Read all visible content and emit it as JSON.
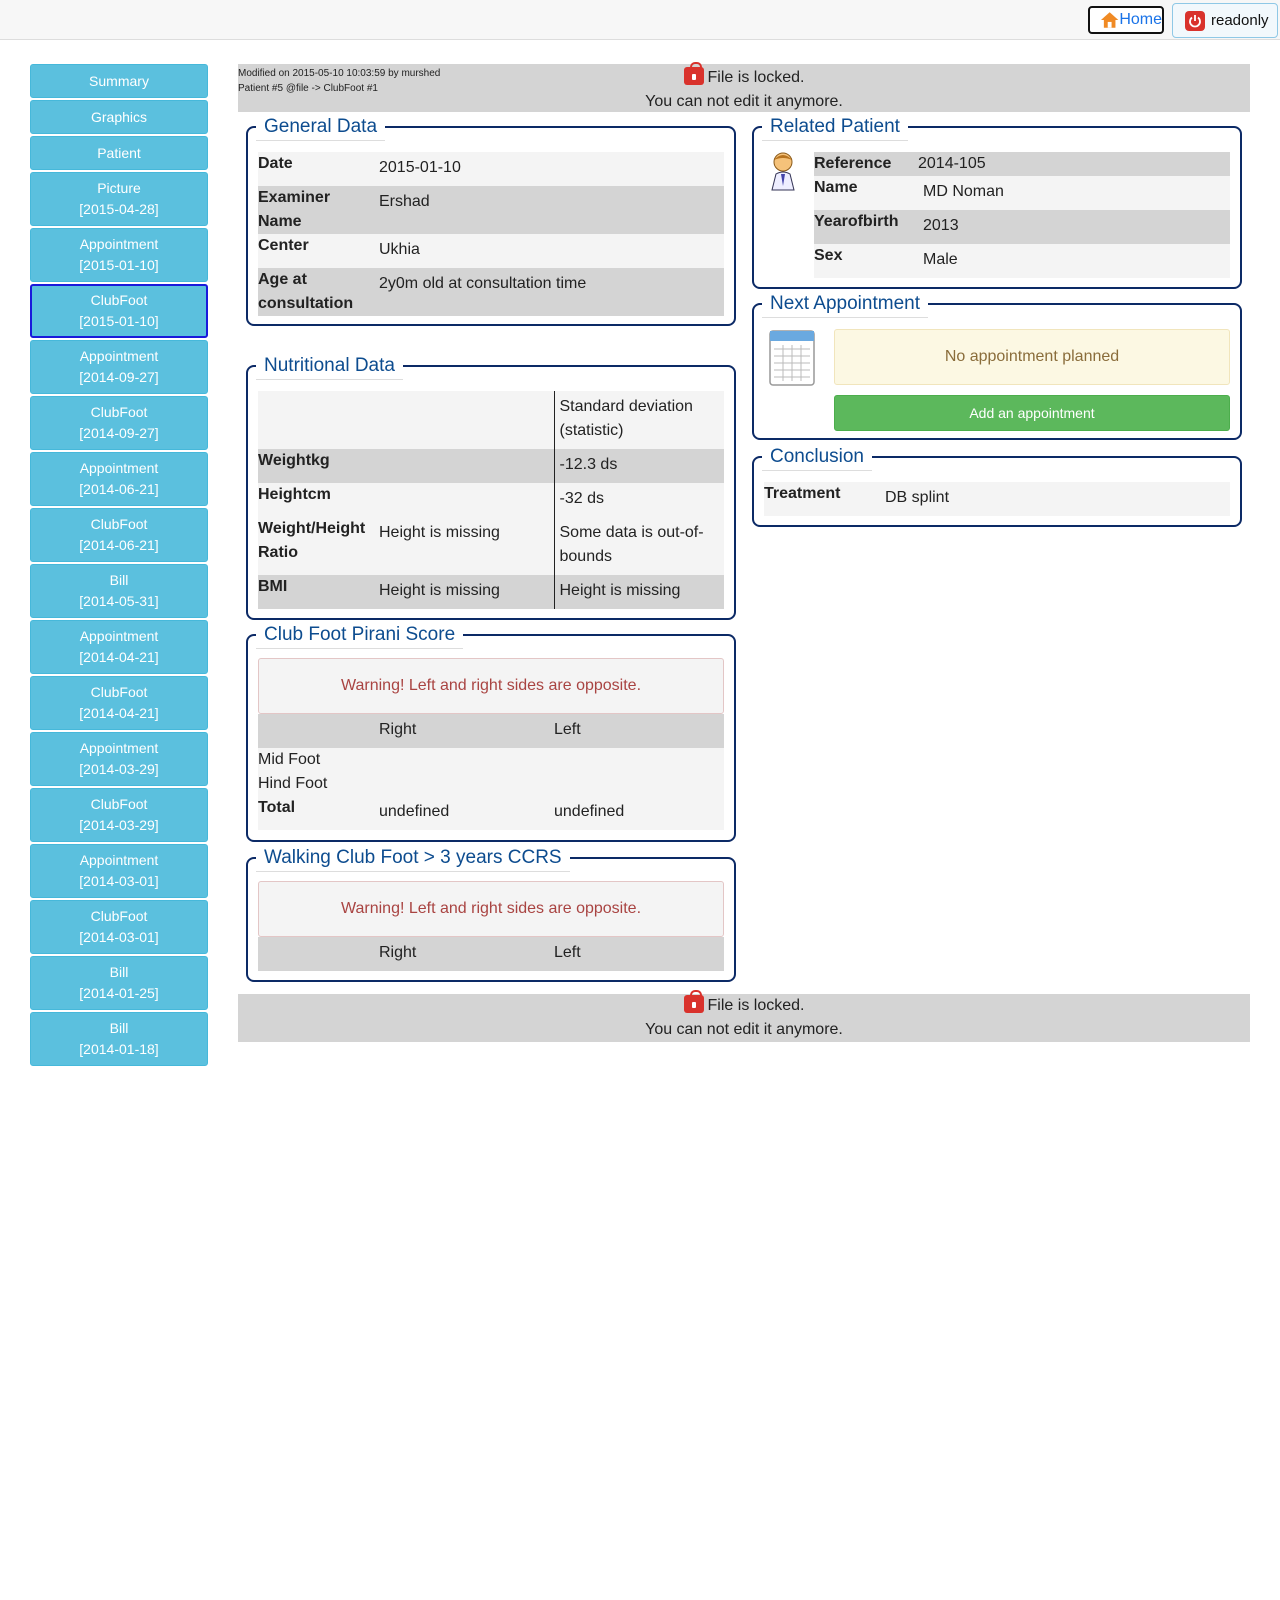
{
  "topbar": {
    "home_label": "Home",
    "readonly_label": "readonly"
  },
  "sidebar": {
    "items": [
      {
        "label": "Summary",
        "date": ""
      },
      {
        "label": "Graphics",
        "date": ""
      },
      {
        "label": "Patient",
        "date": ""
      },
      {
        "label": "Picture",
        "date": "[2015-04-28]"
      },
      {
        "label": "Appointment",
        "date": "[2015-01-10]"
      },
      {
        "label": "ClubFoot",
        "date": "[2015-01-10]"
      },
      {
        "label": "Appointment",
        "date": "[2014-09-27]"
      },
      {
        "label": "ClubFoot",
        "date": "[2014-09-27]"
      },
      {
        "label": "Appointment",
        "date": "[2014-06-21]"
      },
      {
        "label": "ClubFoot",
        "date": "[2014-06-21]"
      },
      {
        "label": "Bill",
        "date": "[2014-05-31]"
      },
      {
        "label": "Appointment",
        "date": "[2014-04-21]"
      },
      {
        "label": "ClubFoot",
        "date": "[2014-04-21]"
      },
      {
        "label": "Appointment",
        "date": "[2014-03-29]"
      },
      {
        "label": "ClubFoot",
        "date": "[2014-03-29]"
      },
      {
        "label": "Appointment",
        "date": "[2014-03-01]"
      },
      {
        "label": "ClubFoot",
        "date": "[2014-03-01]"
      },
      {
        "label": "Bill",
        "date": "[2014-01-25]"
      },
      {
        "label": "Bill",
        "date": "[2014-01-18]"
      }
    ]
  },
  "lock": {
    "modified": "Modified on 2015-05-10 10:03:59 by murshed",
    "patient_ref": "Patient #5 @file -> ClubFoot #1",
    "line1": "File is locked.",
    "line2": "You can not edit it anymore."
  },
  "general": {
    "title": "General Data",
    "date_label": "Date",
    "date_value": "2015-01-10",
    "examiner_label1": "Examiner",
    "examiner_label2": "Name",
    "examiner_value": "Ershad",
    "center_label": "Center",
    "center_value": "Ukhia",
    "age_label1": "Age at",
    "age_label2": "consultation",
    "age_value": "2y0m old at consultation time"
  },
  "nutritional": {
    "title": "Nutritional Data",
    "sd_header1": "Standard deviation",
    "sd_header2": "(statistic)",
    "weight_label": "Weightkg",
    "weight_sd": "-12.3 ds",
    "height_label": "Heightcm",
    "height_sd": "-32 ds",
    "wh_label1": "Weight/Height",
    "wh_label2": "Ratio",
    "wh_value": "Height is missing",
    "wh_sd1": "Some data is out-of-",
    "wh_sd2": "bounds",
    "bmi_label": "BMI",
    "bmi_value": "Height is missing",
    "bmi_sd": "Height is missing"
  },
  "pirani": {
    "title": "Club Foot Pirani Score",
    "warning": "Warning! Left and right sides are opposite.",
    "right": "Right",
    "left": "Left",
    "mid_foot": "Mid Foot",
    "hind_foot": "Hind Foot",
    "total_label": "Total",
    "total_right": "undefined",
    "total_left": "undefined"
  },
  "walking": {
    "title": "Walking Club Foot > 3 years CCRS",
    "warning": "Warning! Left and right sides are opposite.",
    "right": "Right",
    "left": "Left"
  },
  "related": {
    "title": "Related Patient",
    "reference_label": "Reference",
    "reference_value": "2014-105",
    "name_label": "Name",
    "name_value": "MD Noman",
    "yob_label": "Yearofbirth",
    "yob_value": "2013",
    "sex_label": "Sex",
    "sex_value": "Male"
  },
  "next_appointment": {
    "title": "Next Appointment",
    "none_text": "No appointment planned",
    "add_label": "Add an appointment"
  },
  "conclusion": {
    "title": "Conclusion",
    "treatment_label": "Treatment",
    "treatment_value": "DB splint"
  }
}
